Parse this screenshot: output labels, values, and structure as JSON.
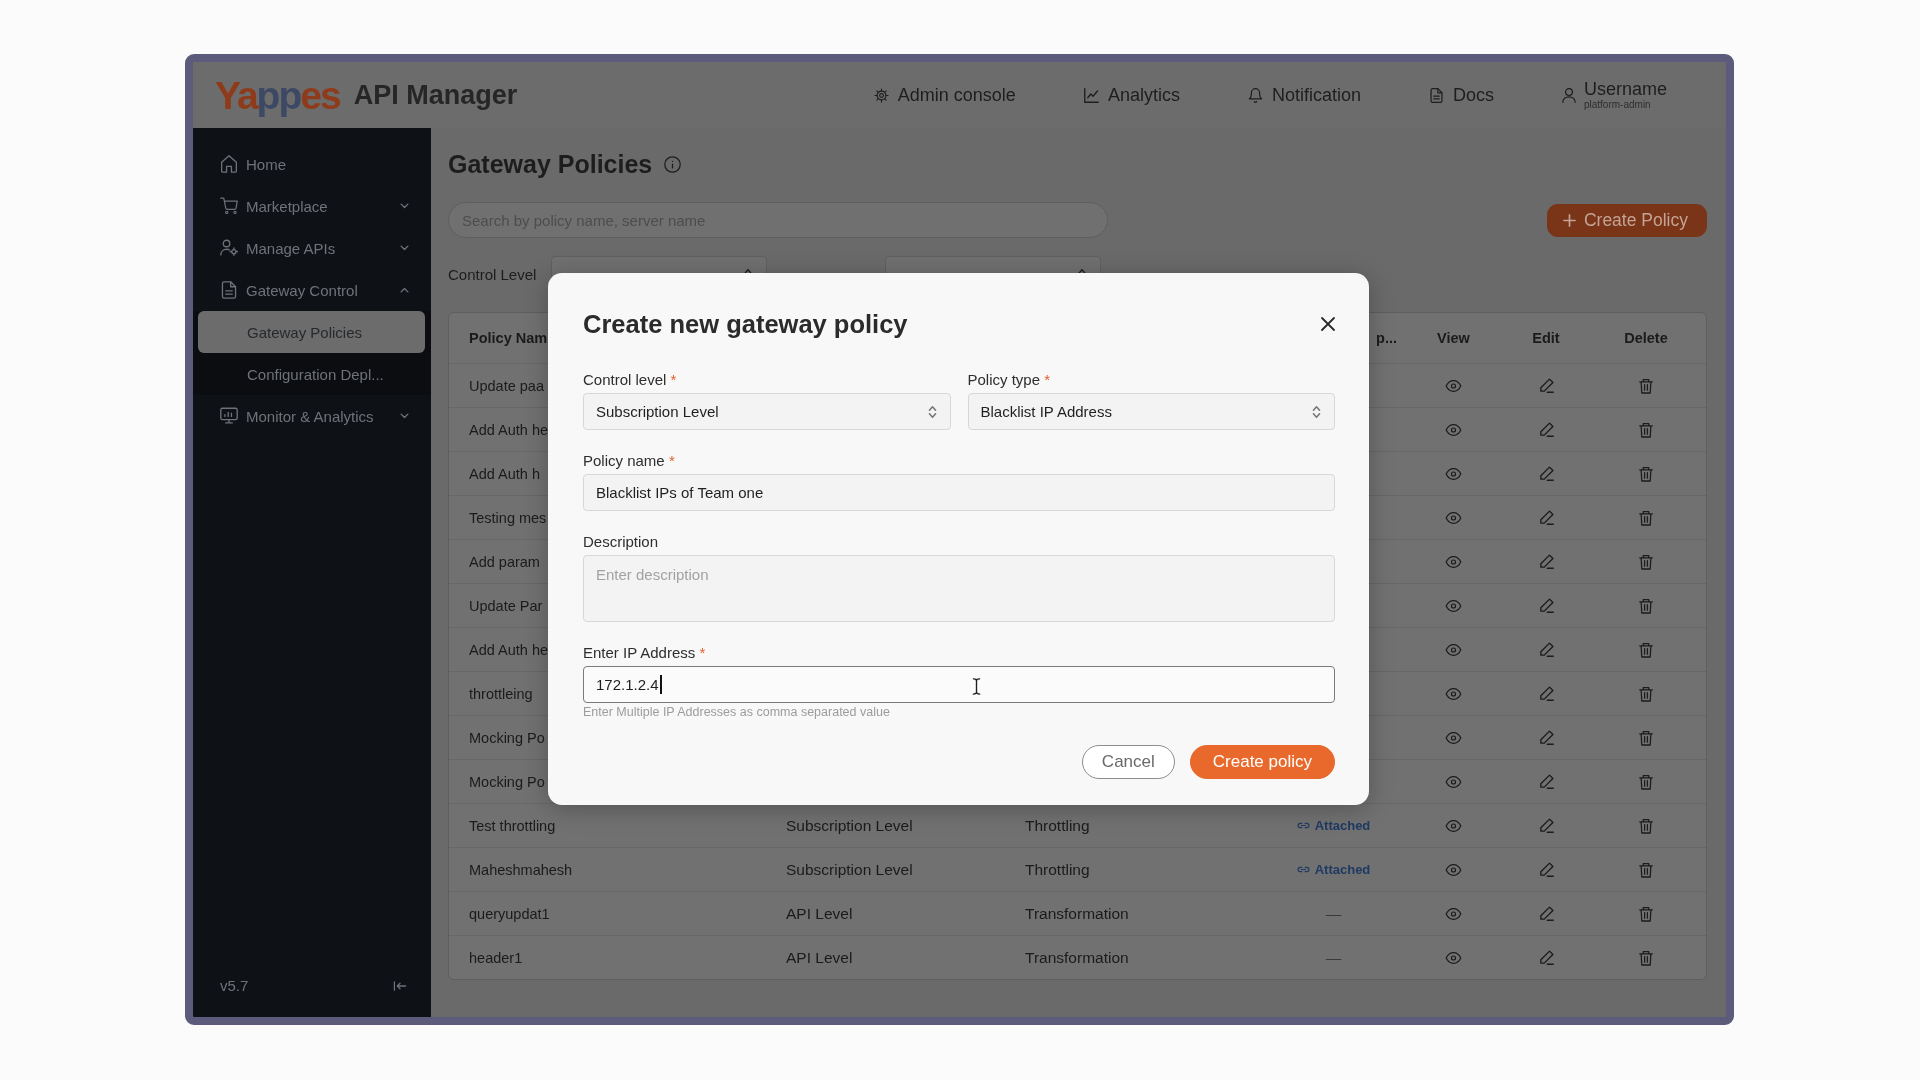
{
  "header": {
    "logo": "Yappes",
    "product": "API Manager",
    "nav": [
      {
        "label": "Admin console"
      },
      {
        "label": "Analytics"
      },
      {
        "label": "Notification"
      },
      {
        "label": "Docs"
      }
    ],
    "user": {
      "name": "Username",
      "role": "platform-admin"
    }
  },
  "sidebar": {
    "items": [
      {
        "kind": "link",
        "label": "Home",
        "selected": false
      },
      {
        "kind": "group",
        "label": "Marketplace",
        "selected": false,
        "expanded": false
      },
      {
        "kind": "group",
        "label": "Manage APIs",
        "selected": false,
        "expanded": false
      },
      {
        "kind": "group",
        "label": "Gateway Control",
        "selected": false,
        "expanded": true,
        "children": [
          {
            "label": "Gateway Policies",
            "selected": true
          },
          {
            "label": "Configuration Depl...",
            "selected": false
          }
        ]
      },
      {
        "kind": "group",
        "label": "Monitor & Analytics",
        "selected": false,
        "expanded": false
      }
    ],
    "version": "v5.7"
  },
  "page": {
    "title": "Gateway Policies",
    "search": {
      "placeholder": "Search by policy name, server name"
    },
    "create_button": "Create Policy",
    "filters": [
      {
        "kind": "label",
        "text": "Control Level"
      },
      {
        "kind": "select"
      },
      {
        "kind": "select"
      }
    ]
  },
  "table": {
    "columns": [
      "Policy Nam",
      "p...",
      "View",
      "Edit",
      "Delete"
    ],
    "rows": [
      {
        "column_1": "Update paa"
      },
      {
        "column_1": "Add Auth he"
      },
      {
        "column_1": "Add Auth h"
      },
      {
        "column_1": "Testing mes"
      },
      {
        "column_1": "Add param"
      },
      {
        "column_1": "Update Par"
      },
      {
        "column_1": "Add Auth he"
      },
      {
        "column_1": "throttleing"
      },
      {
        "column_1": "Mocking Po"
      },
      {
        "column_1": "Mocking Po"
      },
      {
        "column_1": "Test throttling",
        "column_2": "Subscription Level",
        "column_3": "Throttling",
        "column_4": {
          "kind": "tag",
          "text": "Attached"
        }
      },
      {
        "column_1": "Maheshmahesh",
        "column_2": "Subscription Level",
        "column_3": "Throttling",
        "column_4": {
          "kind": "tag",
          "text": "Attached"
        }
      },
      {
        "column_1": "queryupdat1",
        "column_2": "API Level",
        "column_3": "Transformation",
        "column_4": {
          "kind": "plain",
          "text": "—"
        }
      },
      {
        "column_1": "header1",
        "column_2": "API Level",
        "column_3": "Transformation",
        "column_4": {
          "kind": "plain",
          "text": "—"
        }
      }
    ]
  },
  "dialog": {
    "title": "Create new gateway policy",
    "fields": [
      {
        "kind": "select",
        "label": "Control level",
        "required_mark": "*",
        "value": "Subscription Level",
        "focused": false
      },
      {
        "kind": "select",
        "label": "Policy type",
        "required_mark": "*",
        "value": "Blacklist IP Address",
        "focused": false
      },
      {
        "kind": "text",
        "label": "Policy name",
        "required_mark": "*",
        "value": "Blacklist IPs of Team one",
        "focused": false
      },
      {
        "kind": "textarea",
        "label": "Description",
        "placeholder": "Enter description",
        "focused": false
      },
      {
        "kind": "text",
        "label": "Enter IP Address",
        "required_mark": "*",
        "value": "172.1.2.4",
        "focused": true,
        "hint": "Enter Multiple IP Addresses as comma separated value"
      }
    ],
    "buttons": [
      {
        "kind": "secondary",
        "label": "Cancel"
      },
      {
        "kind": "primary",
        "label": "Create policy"
      }
    ]
  }
}
